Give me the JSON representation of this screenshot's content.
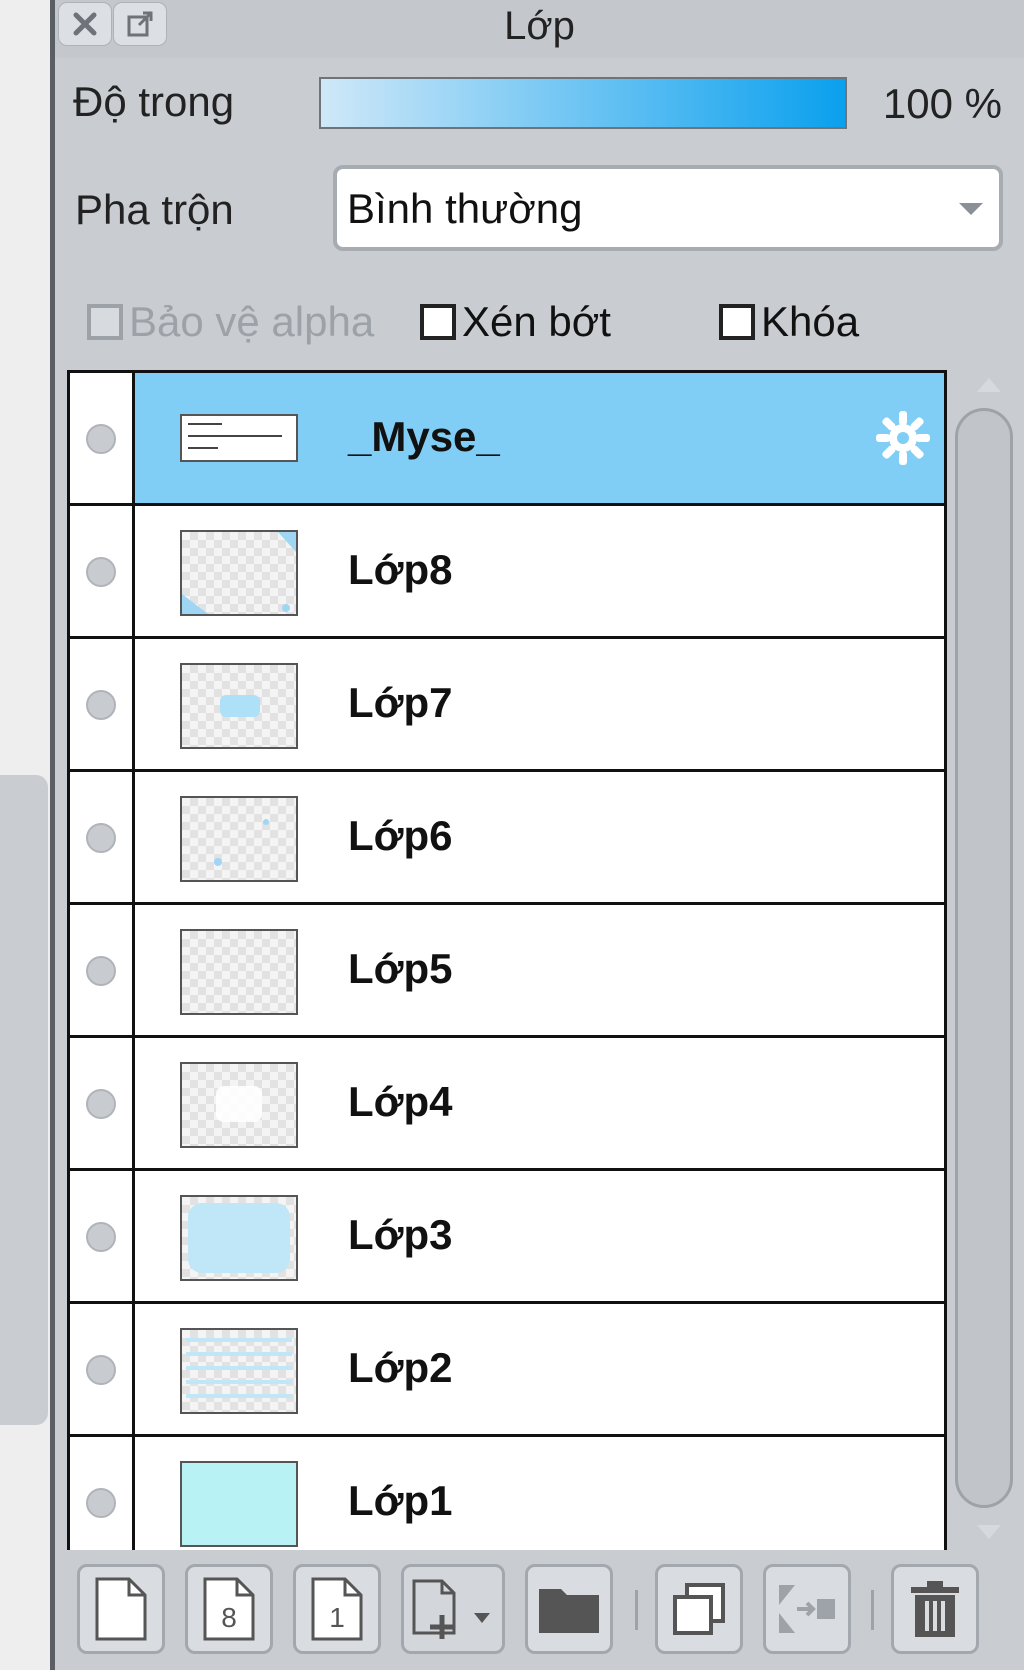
{
  "panel": {
    "title": "Lớp",
    "opacity_label": "Độ trong",
    "opacity_value": "100 %",
    "opacity_fraction": 1.0,
    "blend_label": "Pha trộn",
    "blend_value": "Bình thường",
    "checkboxes": {
      "alpha_protect": "Bảo vệ alpha",
      "clipping": "Xén bớt",
      "lock": "Khóa"
    }
  },
  "layers": [
    {
      "name": "_Myse_",
      "selected": true
    },
    {
      "name": "Lớp8"
    },
    {
      "name": "Lớp7"
    },
    {
      "name": "Lớp6"
    },
    {
      "name": "Lớp5"
    },
    {
      "name": "Lớp4"
    },
    {
      "name": "Lớp3"
    },
    {
      "name": "Lớp2"
    },
    {
      "name": "Lớp1"
    }
  ],
  "toolbar_icons": [
    "new-layer-icon",
    "new-8bit-layer-icon",
    "new-1bit-layer-icon",
    "add-layer-dropdown-icon",
    "folder-icon",
    "duplicate-icon",
    "merge-down-icon",
    "trash-icon"
  ],
  "colors": {
    "selected_row": "#80cef6",
    "opacity_gradient_end": "#0aa0ee"
  }
}
